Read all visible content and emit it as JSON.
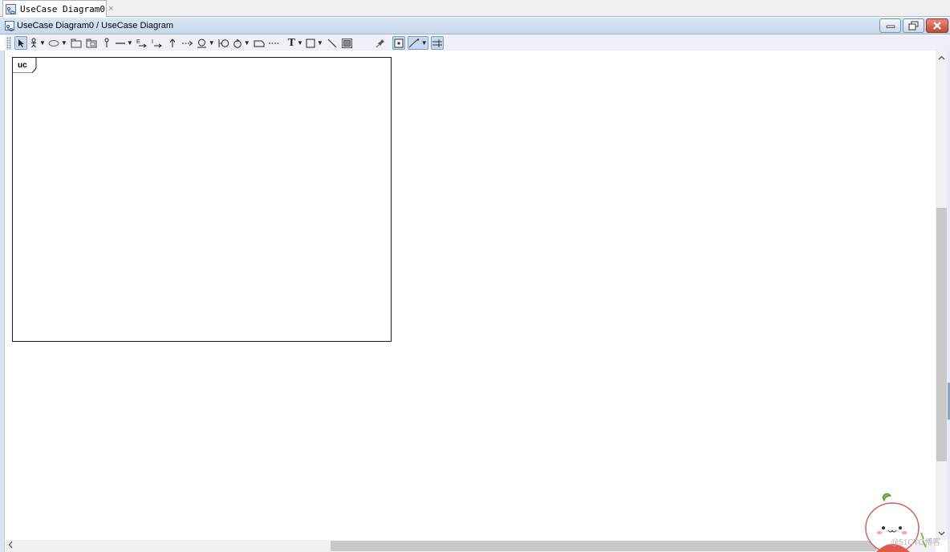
{
  "tab": {
    "label": "UseCase Diagram0",
    "close": "×"
  },
  "window": {
    "title": "UseCase Diagram0 / UseCase Diagram"
  },
  "toolbar": {
    "tools": [
      {
        "name": "select-tool",
        "active": true
      },
      {
        "name": "actor-tool",
        "dropdown": true
      },
      {
        "name": "usecase-tool",
        "dropdown": true
      },
      {
        "name": "package-tool"
      },
      {
        "name": "subsystem-tool"
      },
      {
        "name": "stick-tool"
      },
      {
        "name": "association-tool",
        "dropdown": true
      },
      {
        "name": "extend-tool"
      },
      {
        "name": "include-tool"
      },
      {
        "name": "generalization-tool"
      },
      {
        "name": "dependency-tool"
      },
      {
        "name": "boundary-tool",
        "dropdown": true
      },
      {
        "name": "entity-tool"
      },
      {
        "name": "control-tool",
        "dropdown": true
      },
      {
        "name": "note-tool"
      },
      {
        "name": "note-anchor-tool"
      },
      {
        "name": "text-tool",
        "label": "T",
        "dropdown": true
      },
      {
        "name": "rectangle-tool",
        "dropdown": true
      },
      {
        "name": "line-tool"
      },
      {
        "name": "image-tool"
      },
      {
        "name": "pin-tool"
      },
      {
        "name": "snap-grid-tool",
        "active": true
      },
      {
        "name": "line-style-tool",
        "active": true,
        "dropdown": true
      },
      {
        "name": "align-tool",
        "active": true
      }
    ]
  },
  "diagram": {
    "frame_label": "uc"
  },
  "watermark": {
    "text": "@51CTO博客"
  }
}
